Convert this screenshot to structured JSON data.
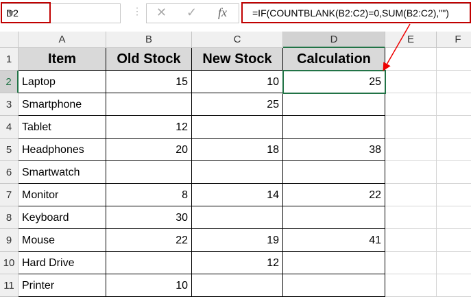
{
  "name_box": "D2",
  "formula": "=IF(COUNTBLANK(B2:C2)=0,SUM(B2:C2),\"\")",
  "columns": [
    "A",
    "B",
    "C",
    "D",
    "E",
    "F"
  ],
  "headers": [
    "Item",
    "Old Stock",
    "New Stock",
    "Calculation"
  ],
  "rows": [
    {
      "n": "2",
      "item": "Laptop",
      "old": "15",
      "new": "10",
      "calc": "25"
    },
    {
      "n": "3",
      "item": "Smartphone",
      "old": "",
      "new": "25",
      "calc": ""
    },
    {
      "n": "4",
      "item": "Tablet",
      "old": "12",
      "new": "",
      "calc": ""
    },
    {
      "n": "5",
      "item": "Headphones",
      "old": "20",
      "new": "18",
      "calc": "38"
    },
    {
      "n": "6",
      "item": "Smartwatch",
      "old": "",
      "new": "",
      "calc": ""
    },
    {
      "n": "7",
      "item": "Monitor",
      "old": "8",
      "new": "14",
      "calc": "22"
    },
    {
      "n": "8",
      "item": "Keyboard",
      "old": "30",
      "new": "",
      "calc": ""
    },
    {
      "n": "9",
      "item": "Mouse",
      "old": "22",
      "new": "19",
      "calc": "41"
    },
    {
      "n": "10",
      "item": "Hard Drive",
      "old": "",
      "new": "12",
      "calc": ""
    },
    {
      "n": "11",
      "item": "Printer",
      "old": "10",
      "new": "",
      "calc": ""
    }
  ],
  "row1": "1",
  "accent": "#217346",
  "highlight": "#c00000"
}
